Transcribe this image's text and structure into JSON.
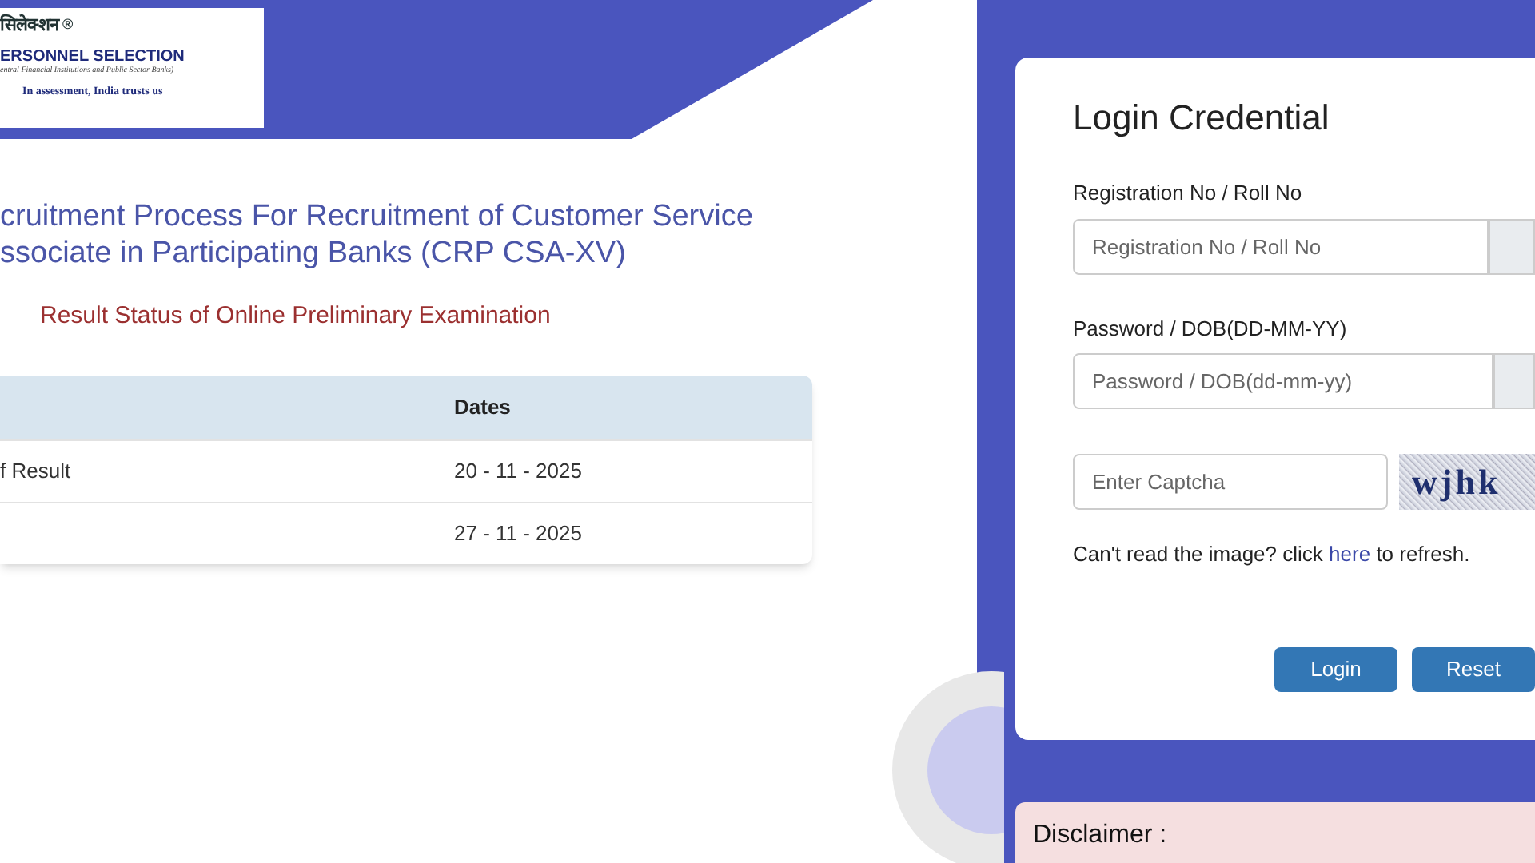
{
  "logo": {
    "hindi": "सिलेक्शन",
    "mark": "®",
    "name": "ERSONNEL SELECTION",
    "sub": "entral Financial Institutions and Public Sector Banks)",
    "tagline": "In assessment, India trusts us"
  },
  "heading": {
    "lines": [
      "cruitment Process For Recruitment of Customer Service",
      "ssociate in Participating Banks (CRP CSA-XV)"
    ],
    "subtitle": "Result Status of Online Preliminary Examination"
  },
  "table": {
    "columns": [
      "",
      "Dates"
    ],
    "rows": [
      [
        "f Result",
        "20 - 11 - 2025"
      ],
      [
        "",
        "27 - 11 - 2025"
      ]
    ]
  },
  "login": {
    "title": "Login Credential",
    "fields": [
      {
        "label": "Registration No / Roll No",
        "placeholder": "Registration No / Roll No"
      },
      {
        "label": "Password / DOB(DD-MM-YY)",
        "placeholder": "Password / DOB(dd-mm-yy)"
      }
    ],
    "captcha": {
      "placeholder": "Enter Captcha",
      "code": "wjhk"
    },
    "refresh": {
      "before": "Can't read the image? click",
      "link": "here",
      "after": "to refresh."
    },
    "buttons": [
      "Login",
      "Reset"
    ]
  },
  "disclaimer": {
    "title": "Disclaimer :"
  }
}
